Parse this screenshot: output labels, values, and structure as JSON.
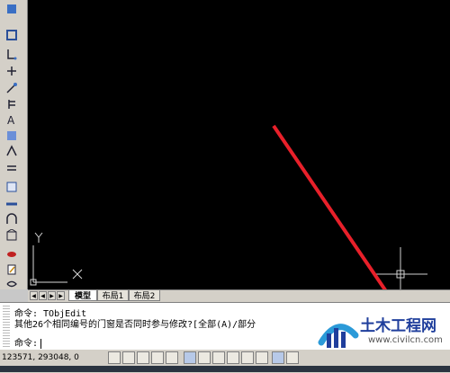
{
  "layout_tabs": [
    {
      "label": "模型",
      "active": true
    },
    {
      "label": "布局1",
      "active": false
    },
    {
      "label": "布局2",
      "active": false
    }
  ],
  "ucs": {
    "y_label": "Y",
    "x_label": "X"
  },
  "command_history": [
    "命令: TObjEdit",
    "其他26个相同编号的门窗是否同时参与修改?[全部(A)/部分"
  ],
  "command_prompt": "命令:",
  "status": {
    "coordinates": "123571, 293048, 0"
  },
  "watermark": {
    "name": "土木工程网",
    "url": "www.civilcn.com"
  },
  "colors": {
    "arrow": "#e8202a",
    "canvas": "#000000",
    "logo_blue": "#1f3e9c"
  },
  "toolbar_icons": [
    "line-icon",
    "polyline-icon",
    "construction-icon",
    "rectangle-icon",
    "arc-icon",
    "circle-icon",
    "spline-icon",
    "ellipse-icon",
    "text-icon",
    "block-icon",
    "insert-icon",
    "point-icon",
    "hatch-icon",
    "region-icon",
    "table-icon",
    "gradient-icon",
    "mtext-icon",
    "hatch2-icon",
    "boundary-icon",
    "revcloud-icon",
    "wipeout-icon",
    "dim-icon"
  ]
}
